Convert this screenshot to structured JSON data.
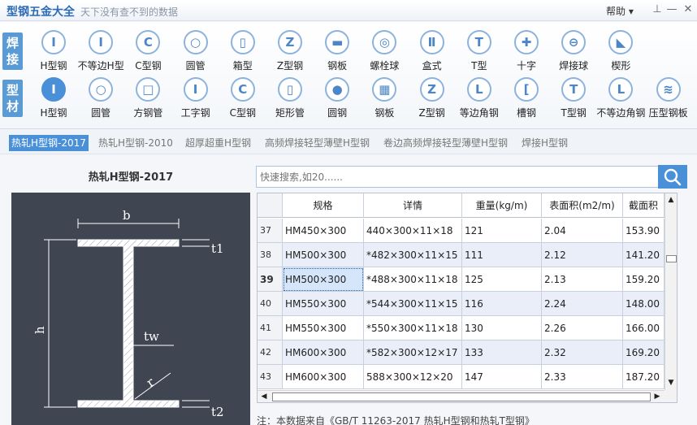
{
  "window": {
    "title": "型钢五金大全",
    "slogan": "天下没有查不到的数据",
    "help_label": "帮助",
    "pin_glyph": "⊥",
    "min_glyph": "—",
    "close_glyph": "✕"
  },
  "toolbar": {
    "weld_label": "焊接",
    "section_label": "型材",
    "weld_items": [
      {
        "label": "H型钢",
        "glyph": "I"
      },
      {
        "label": "不等边H型",
        "glyph": "I"
      },
      {
        "label": "C型钢",
        "glyph": "C"
      },
      {
        "label": "圆管",
        "glyph": "○"
      },
      {
        "label": "箱型",
        "glyph": "▯"
      },
      {
        "label": "Z型钢",
        "glyph": "Z"
      },
      {
        "label": "钢板",
        "glyph": "▬"
      },
      {
        "label": "螺栓球",
        "glyph": "◎"
      },
      {
        "label": "盒式",
        "glyph": "Ⅱ"
      },
      {
        "label": "T型",
        "glyph": "T"
      },
      {
        "label": "十字",
        "glyph": "✚"
      },
      {
        "label": "焊接球",
        "glyph": "⊖"
      },
      {
        "label": "楔形",
        "glyph": "◣"
      }
    ],
    "section_items": [
      {
        "label": "H型钢",
        "glyph": "I"
      },
      {
        "label": "圆管",
        "glyph": "○"
      },
      {
        "label": "方钢管",
        "glyph": "□"
      },
      {
        "label": "工字钢",
        "glyph": "I"
      },
      {
        "label": "C型钢",
        "glyph": "C"
      },
      {
        "label": "矩形管",
        "glyph": "▯"
      },
      {
        "label": "圆钢",
        "glyph": "●"
      },
      {
        "label": "钢板",
        "glyph": "▦"
      },
      {
        "label": "Z型钢",
        "glyph": "Z"
      },
      {
        "label": "等边角钢",
        "glyph": "L"
      },
      {
        "label": "槽钢",
        "glyph": "["
      },
      {
        "label": "T型钢",
        "glyph": "T"
      },
      {
        "label": "不等边角钢",
        "glyph": "L"
      },
      {
        "label": "压型钢板",
        "glyph": "≋"
      }
    ]
  },
  "tabs": [
    "热轧H型钢-2017",
    "热轧H型钢-2010",
    "超厚超重H型钢",
    "高频焊接轻型薄壁H型钢",
    "卷边高频焊接轻型薄壁H型钢",
    "焊接H型钢"
  ],
  "diagram": {
    "title": "热轧H型钢-2017",
    "labels": {
      "b": "b",
      "h": "h",
      "t1": "t1",
      "t2": "t2",
      "tw": "tw",
      "r": "r"
    }
  },
  "search": {
    "placeholder": "快速搜索,如20......",
    "icon": "search-icon"
  },
  "table": {
    "headers": [
      "规格",
      "详情",
      "重量(kg/m)",
      "表面积(m2/m)",
      "截面积"
    ],
    "rows": [
      {
        "num": "37",
        "spec": "HM450×300",
        "detail": "440×300×11×18",
        "weight": "121",
        "surface": "2.04",
        "area": "153.90"
      },
      {
        "num": "38",
        "spec": "HM500×300",
        "detail": "*482×300×11×15",
        "weight": "111",
        "surface": "2.12",
        "area": "141.20"
      },
      {
        "num": "39",
        "spec": "HM500×300",
        "detail": "*488×300×11×18",
        "weight": "125",
        "surface": "2.13",
        "area": "159.20"
      },
      {
        "num": "40",
        "spec": "HM550×300",
        "detail": "*544×300×11×15",
        "weight": "116",
        "surface": "2.24",
        "area": "148.00"
      },
      {
        "num": "41",
        "spec": "HM550×300",
        "detail": "*550×300×11×18",
        "weight": "130",
        "surface": "2.26",
        "area": "166.00"
      },
      {
        "num": "42",
        "spec": "HM600×300",
        "detail": "*582×300×12×17",
        "weight": "133",
        "surface": "2.32",
        "area": "169.20"
      },
      {
        "num": "43",
        "spec": "HM600×300",
        "detail": "588×300×12×20",
        "weight": "147",
        "surface": "2.33",
        "area": "187.20"
      }
    ]
  },
  "note": "注：本数据来自《GB/T 11263-2017 热轧H型钢和热轧T型钢》",
  "colors": {
    "accent": "#4a90d9",
    "diagram_bg": "#3f4652"
  }
}
